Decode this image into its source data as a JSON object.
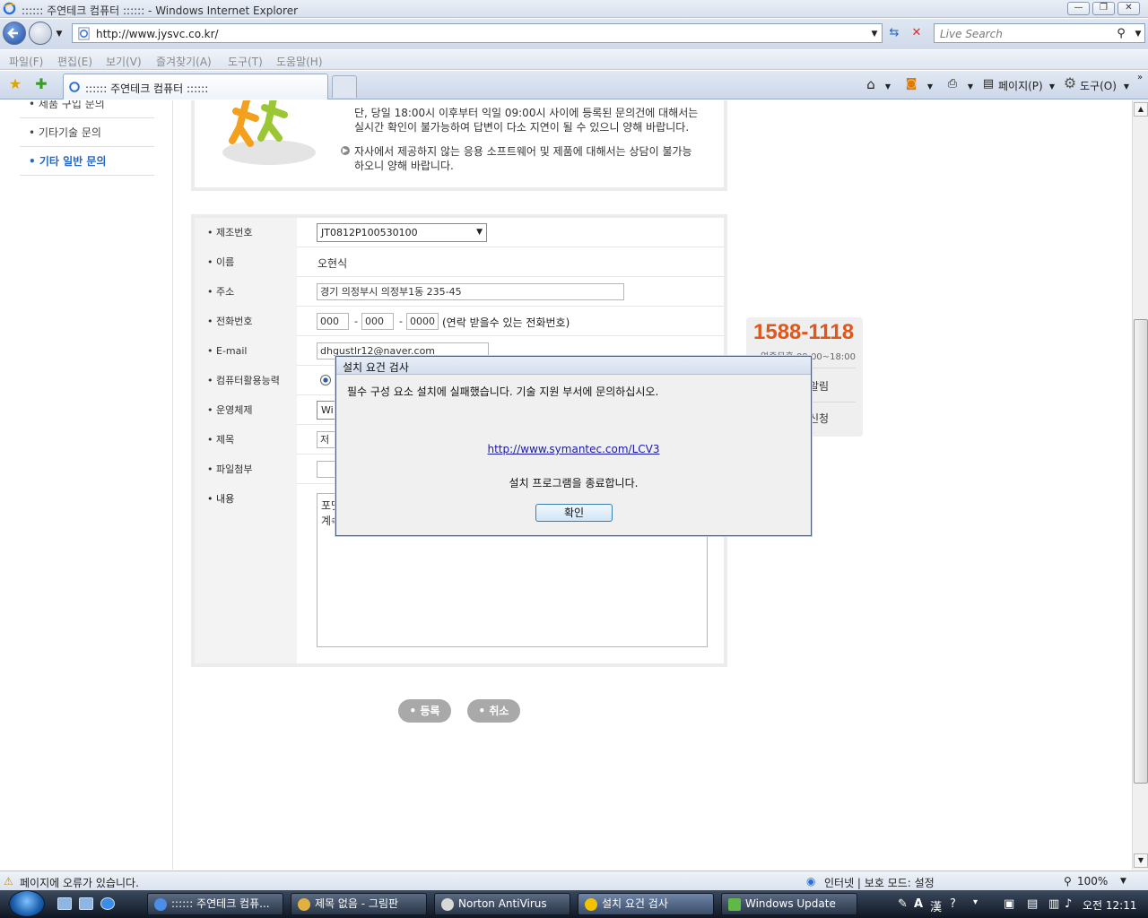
{
  "window": {
    "title": ":::::: 주연테크 컴퓨터 :::::: - Windows Internet Explorer"
  },
  "addressbar": {
    "url": "http://www.jysvc.co.kr/",
    "search_placeholder": "Live Search"
  },
  "menubar": {
    "items": [
      "파일(F)",
      "편집(E)",
      "보기(V)",
      "즐겨찾기(A)",
      "도구(T)",
      "도움말(H)"
    ]
  },
  "tabs": {
    "active_tab": ":::::: 주연테크 컴퓨터 ::::::"
  },
  "toolbar": {
    "page_label": "페이지(P)",
    "tools_label": "도구(O)"
  },
  "left_nav": {
    "items": [
      "제품 구입 문의",
      "기타기술 문의",
      "기타 일반 문의"
    ],
    "active_index": 2
  },
  "notice": {
    "lines": [
      "단, 당일 18:00시 이후부터 익일 09:00시 사이에 등록된 문의건에 대해서는",
      "실시간 확인이 불가능하여 답변이 다소 지연이 될 수 있으니 양해 바랍니다.",
      "자사에서 제공하지 않는 응용 소프트웨어 및 제품에 대해서는 상담이 불가능",
      "하오니 양해 바랍니다."
    ]
  },
  "form": {
    "labels": {
      "serial": "제조번호",
      "name": "이름",
      "address": "주소",
      "phone": "전화번호",
      "email": "E-mail",
      "skill": "컴퓨터활용능력",
      "os": "운영체제",
      "subject": "제목",
      "attachment": "파일첨부",
      "content": "내용"
    },
    "values": {
      "serial": "JT0812P100530100",
      "name": "오현식",
      "address": "경기 의정부시 의정부1동  235-45",
      "phone1": "000",
      "phone2": "000",
      "phone3": "0000",
      "phone_hint": "(연락 받을수 있는 전화번호)",
      "phone_sep": "-",
      "email": "dhgustlr12@naver.com",
      "os_partial": "Wi",
      "subject_partial": "저",
      "content_line1": "포맷",
      "content_line2": "계속"
    },
    "buttons": {
      "submit": "등록",
      "cancel": "취소"
    }
  },
  "callcenter": {
    "number": "1588-1118",
    "hours": "연중무휴 09:00~18:00",
    "menu1": "알림",
    "menu2": "신청"
  },
  "dialog": {
    "title": "설치 요건 검사",
    "message": "필수 구성 요소 설치에 실패했습니다. 기술 지원 부서에 문의하십시오.",
    "link": "http://www.symantec.com/LCV3",
    "end_message": "설치 프로그램을 종료합니다.",
    "ok_label": "확인"
  },
  "statusbar": {
    "error_text": "페이지에 오류가 있습니다.",
    "zone_text": "인터넷 | 보호 모드: 설정",
    "zoom": "100%"
  },
  "taskbar": {
    "tasks": [
      ":::::: 주연테크 컴퓨...",
      "제목 없음 - 그림판",
      "Norton AntiVirus",
      "설치 요건 검사",
      "Windows Update"
    ],
    "clock": "오전 12:11"
  },
  "colors": {
    "accent_blue": "#2468c4",
    "call_orange": "#e0571b",
    "link": "#1a1aa6"
  }
}
